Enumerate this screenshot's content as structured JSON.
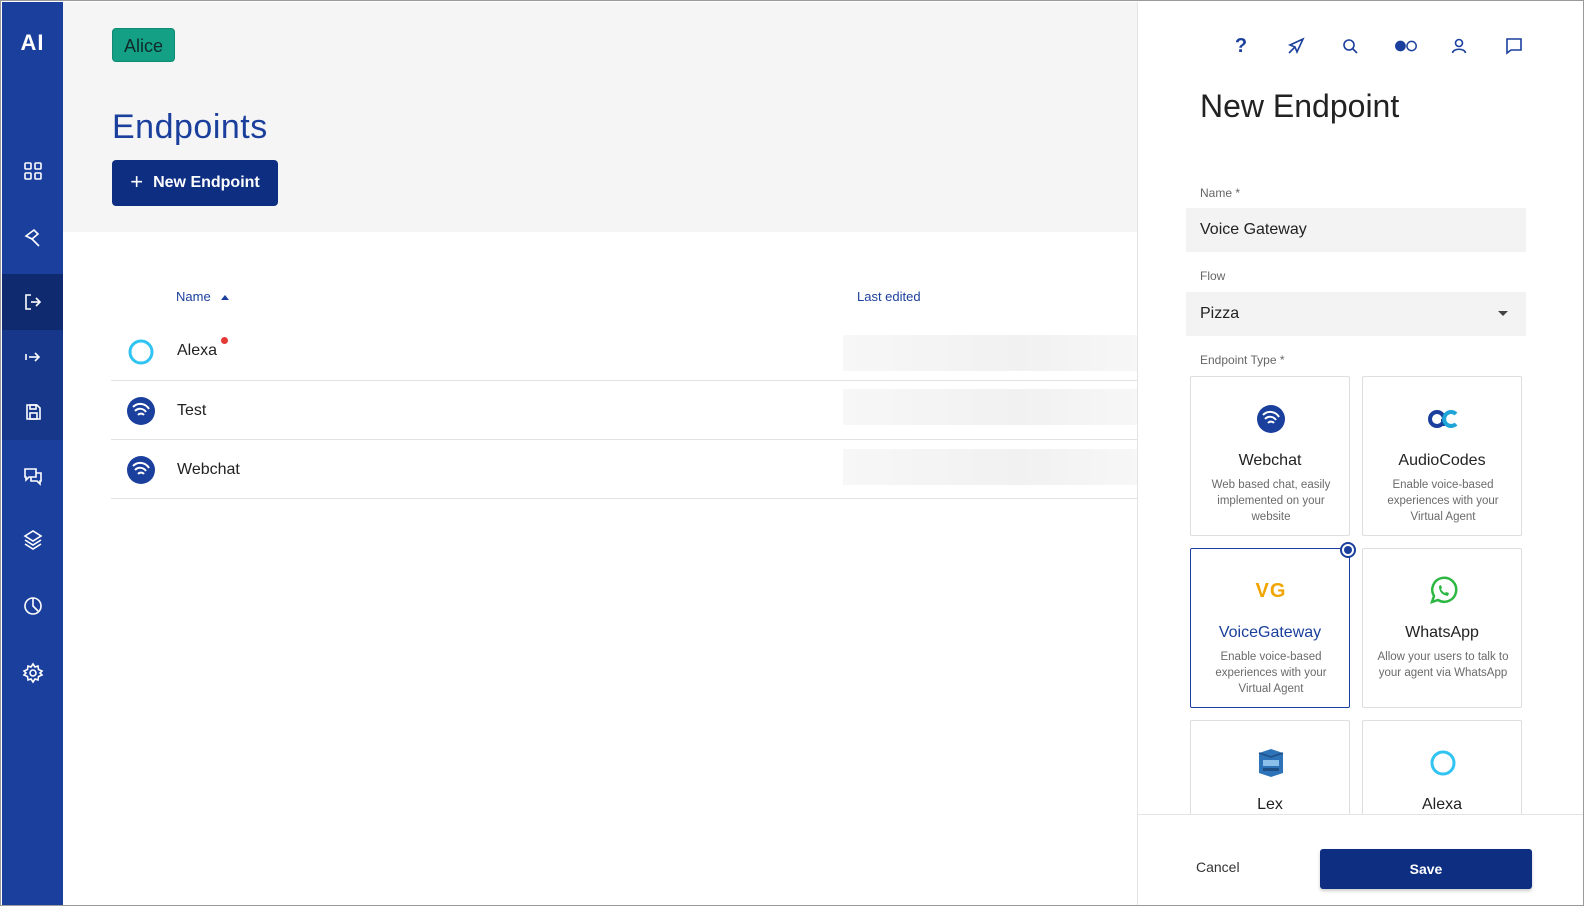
{
  "sidebar": {
    "logo": "AI",
    "items": [
      {
        "icon": "grid-icon"
      },
      {
        "icon": "build-icon"
      },
      {
        "icon": "deploy-icon"
      },
      {
        "icon": "handover-icon"
      },
      {
        "icon": "save-icon"
      },
      {
        "icon": "chat-icon"
      },
      {
        "icon": "layers-icon"
      },
      {
        "icon": "analytics-icon"
      },
      {
        "icon": "settings-icon"
      }
    ]
  },
  "header": {
    "agent_badge": "Alice",
    "page_title": "Endpoints",
    "new_button_label": "New Endpoint"
  },
  "table": {
    "columns": {
      "name": "Name",
      "last_edited": "Last edited"
    },
    "rows": [
      {
        "name": "Alexa",
        "icon": "alexa-icon",
        "has_alert": true
      },
      {
        "name": "Test",
        "icon": "webchat-icon",
        "has_alert": false
      },
      {
        "name": "Webchat",
        "icon": "webchat-icon",
        "has_alert": false
      }
    ]
  },
  "topbar": {
    "icons": [
      "help-icon",
      "compass-icon",
      "search-icon",
      "toggle-icon",
      "user-icon",
      "feedback-icon"
    ],
    "help_glyph": "?"
  },
  "panel": {
    "title": "New Endpoint",
    "name_label": "Name *",
    "name_value": "Voice Gateway",
    "flow_label": "Flow",
    "flow_value": "Pizza",
    "type_label": "Endpoint Type *",
    "types": [
      {
        "name": "Webchat",
        "desc": "Web based chat, easily implemented on your website",
        "icon": "webchat-icon",
        "selected": false
      },
      {
        "name": "AudioCodes",
        "desc": "Enable voice-based experiences with your Virtual Agent",
        "icon": "audiocodes-icon",
        "selected": false
      },
      {
        "name": "VoiceGateway",
        "desc": "Enable voice-based experiences with your Virtual Agent",
        "icon": "voicegateway-icon",
        "selected": true
      },
      {
        "name": "WhatsApp",
        "desc": "Allow your users to talk to your agent via WhatsApp",
        "icon": "whatsapp-icon",
        "selected": false
      },
      {
        "name": "Lex",
        "desc": "",
        "icon": "lex-icon",
        "selected": false
      },
      {
        "name": "Alexa",
        "desc": "",
        "icon": "alexa-icon",
        "selected": false
      }
    ],
    "vg_mark": "VG",
    "cancel_label": "Cancel",
    "save_label": "Save"
  },
  "colors": {
    "sidebar": "#1a3f9c",
    "primary_button": "#0e2e82",
    "badge": "#13a085",
    "accent": "#1a3f9c"
  }
}
